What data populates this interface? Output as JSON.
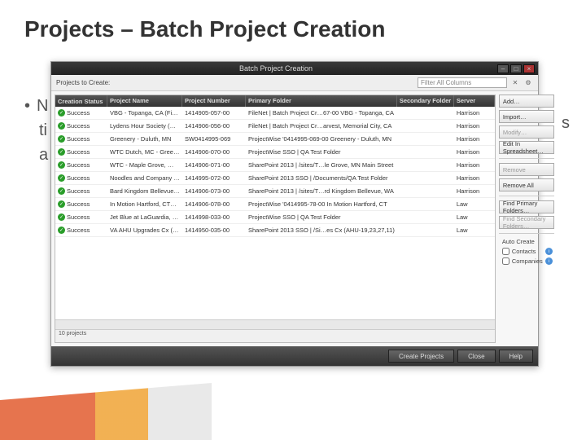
{
  "slide": {
    "title": "Projects – Batch Project Creation",
    "bullet_prefix": "N",
    "bullet_line2": "ti",
    "bullet_line3": "a",
    "right_fragment": "s"
  },
  "dialog": {
    "title": "Batch Project Creation",
    "win_min": "–",
    "win_max": "□",
    "win_close": "×",
    "toolbar_label": "Projects to Create:",
    "filter_placeholder": "Filter All Columns",
    "clear_icon": "✕",
    "gear_icon": "⚙"
  },
  "columns": {
    "status": "Creation Status",
    "name": "Project Name",
    "number": "Project Number",
    "primary": "Primary Folder",
    "secondary": "Secondary Folder",
    "server": "Server"
  },
  "status_label": "Success",
  "rows": [
    {
      "name": "VBG - Topanga, CA (Fi…",
      "num": "1414905-057-00",
      "pri": "FileNet | Batch Project Cr…67-00 VBG - Topanga, CA",
      "srv": "Harrison"
    },
    {
      "name": "Lydens Hour Society (H…",
      "num": "1414906-056-00",
      "pri": "FileNet | Batch Project Cr…arvest, Memorial City, CA",
      "srv": "Harrison"
    },
    {
      "name": "Greenery - Duluth, MN",
      "num": "SW0414995-069",
      "pri": "ProjectWise '0414995-069-00 Greenery - Duluth, MN",
      "srv": "Harrison"
    },
    {
      "name": "WTC Dutch, MC - Greec…",
      "num": "1414906-070-00",
      "pri": "ProjectWise SSO | QA Test Folder",
      "srv": "Harrison"
    },
    {
      "name": "WTC - Maple Grove, …",
      "num": "1414906-071-00",
      "pri": "SharePoint 2013 | /sites/T…le Grove, MN Main Street",
      "srv": "Harrison"
    },
    {
      "name": "Noodles and Company …",
      "num": "1414995-072-00",
      "pri": "SharePoint 2013 SSO | /Documents/QA Test Folder",
      "srv": "Harrison"
    },
    {
      "name": "Bard Kingdom Bellevue…",
      "num": "1414906-073-00",
      "pri": "SharePoint 2013 | /sites/T…rd Kingdom Bellevue, WA",
      "srv": "Harrison"
    },
    {
      "name": "In Motion Hartford, CT…",
      "num": "1414906-078-00",
      "pri": "ProjectWise '0414995-78-00 In Motion Hartford, CT",
      "srv": "Law"
    },
    {
      "name": "Jet Blue at LaGuardia, N…",
      "num": "1414998-033-00",
      "pri": "ProjectWise SSO | QA Test Folder",
      "srv": "Law"
    },
    {
      "name": "VA AHU Upgrades Cx (…",
      "num": "1414950-035-00",
      "pri": "SharePoint 2013 SSO | /Si…es Cx (AHU-19,23,27,11)",
      "srv": "Law"
    }
  ],
  "status_line": "10 projects",
  "sidebar": {
    "add": "Add…",
    "import": "Import…",
    "modify": "Modify…",
    "editspread": "Edit In Spreadsheet…",
    "remove": "Remove",
    "removeall": "Remove All",
    "findpri": "Find Primary Folders…",
    "findsec": "Find Secondary Folders…",
    "autocreate": "Auto Create",
    "contacts": "Contacts",
    "companies": "Companies"
  },
  "footer": {
    "create": "Create Projects",
    "close": "Close",
    "help": "Help"
  }
}
